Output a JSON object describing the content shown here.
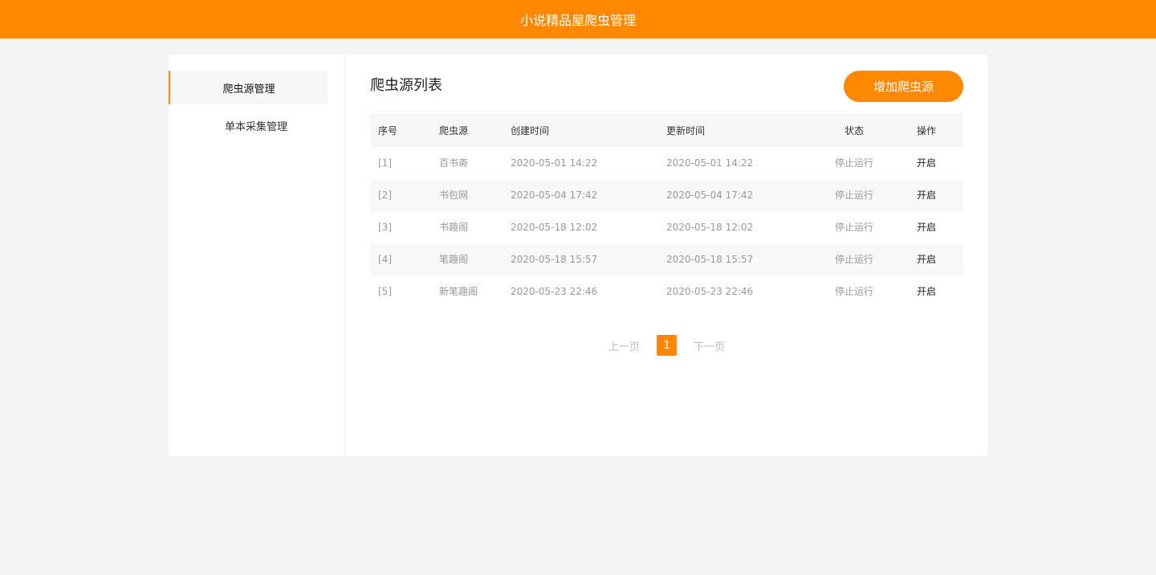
{
  "header": {
    "title": "小说精品屋爬虫管理"
  },
  "sidebar": {
    "items": [
      {
        "label": "爬虫源管理",
        "active": true
      },
      {
        "label": "单本采集管理",
        "active": false
      }
    ]
  },
  "main": {
    "title": "爬虫源列表",
    "add_button": "增加爬虫源",
    "table": {
      "headers": [
        "序号",
        "爬虫源",
        "创建时间",
        "更新时间",
        "状态",
        "操作"
      ],
      "rows": [
        {
          "index": "[1]",
          "source": "百书斋",
          "created": "2020-05-01 14:22",
          "updated": "2020-05-01 14:22",
          "status": "停止运行",
          "action": "开启"
        },
        {
          "index": "[2]",
          "source": "书包网",
          "created": "2020-05-04 17:42",
          "updated": "2020-05-04 17:42",
          "status": "停止运行",
          "action": "开启"
        },
        {
          "index": "[3]",
          "source": "书趣阁",
          "created": "2020-05-18 12:02",
          "updated": "2020-05-18 12:02",
          "status": "停止运行",
          "action": "开启"
        },
        {
          "index": "[4]",
          "source": "笔趣阁",
          "created": "2020-05-18 15:57",
          "updated": "2020-05-18 15:57",
          "status": "停止运行",
          "action": "开启"
        },
        {
          "index": "[5]",
          "source": "新笔趣阁",
          "created": "2020-05-23 22:46",
          "updated": "2020-05-23 22:46",
          "status": "停止运行",
          "action": "开启"
        }
      ]
    },
    "pagination": {
      "prev": "上一页",
      "current": "1",
      "next": "下一页"
    }
  },
  "colors": {
    "accent": "#ff8800",
    "background": "#f4f4f4"
  }
}
